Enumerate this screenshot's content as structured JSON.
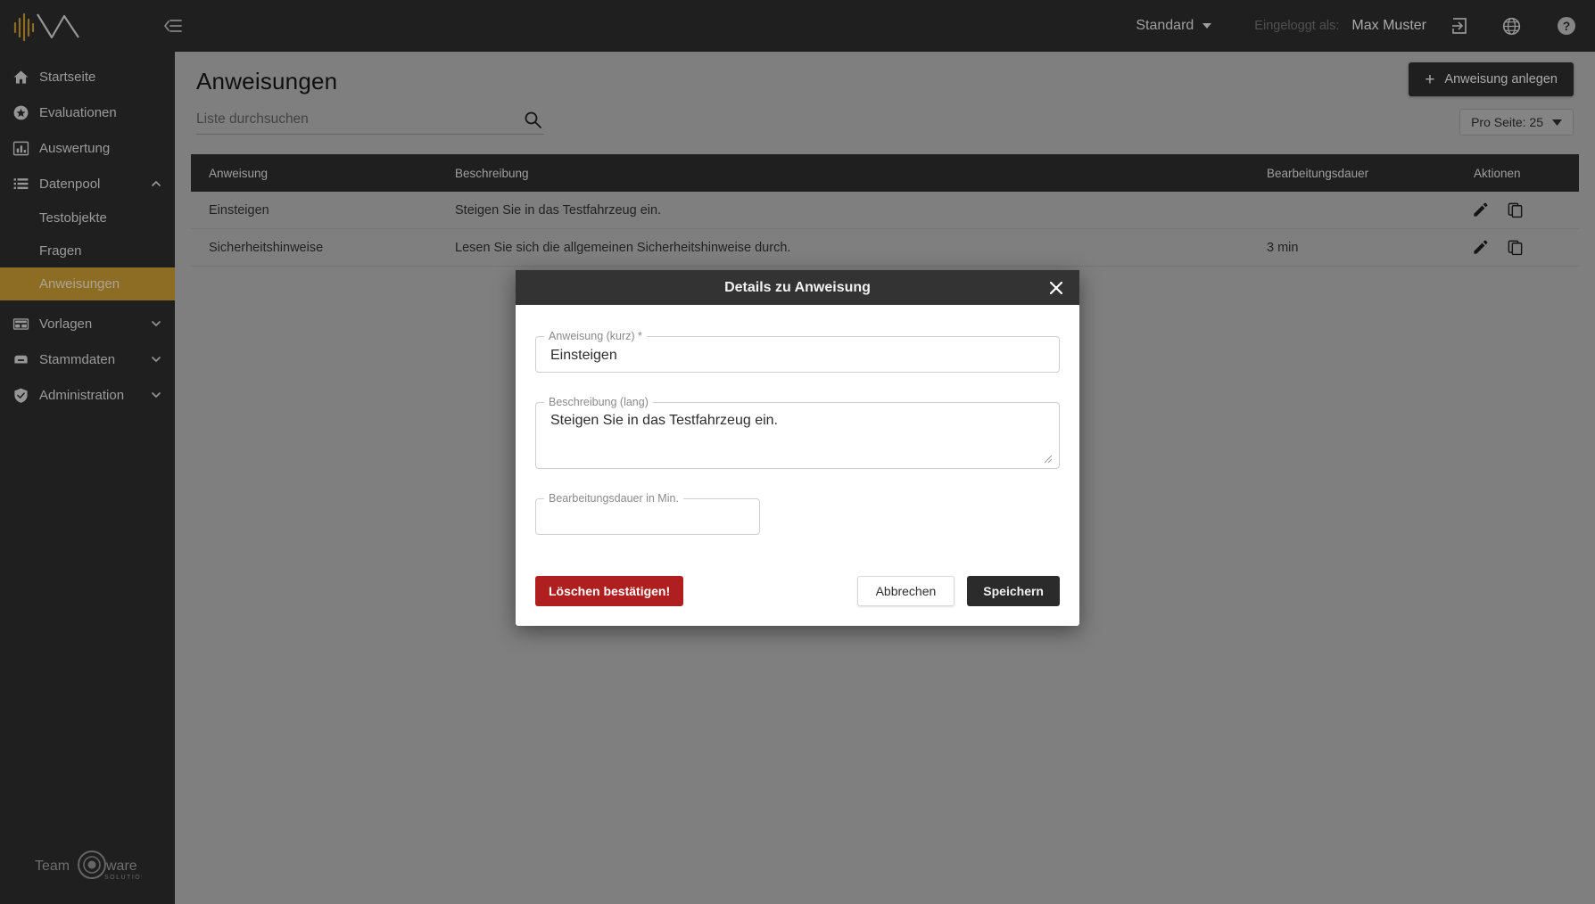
{
  "topbar": {
    "logo_name": "teamware-logo",
    "collapse_icon": "collapse-sidebar-icon",
    "profile_select": "Standard",
    "logged_in_label": "Eingeloggt als:",
    "user_name": "Max Muster",
    "logout_icon": "logout-icon",
    "language_icon": "globe-icon",
    "help_icon": "help-circle-icon"
  },
  "sidebar": {
    "items": [
      {
        "label": "Startseite",
        "icon": "home-icon",
        "level": 0,
        "active": false,
        "chevron": ""
      },
      {
        "label": "Evaluationen",
        "icon": "star-circle-icon",
        "level": 0,
        "active": false,
        "chevron": ""
      },
      {
        "label": "Auswertung",
        "icon": "bar-chart-icon",
        "level": 0,
        "active": false,
        "chevron": ""
      },
      {
        "label": "Datenpool",
        "icon": "database-list-icon",
        "level": 0,
        "active": false,
        "chevron": "up"
      },
      {
        "label": "Testobjekte",
        "icon": "",
        "level": 1,
        "active": false,
        "chevron": ""
      },
      {
        "label": "Fragen",
        "icon": "",
        "level": 1,
        "active": false,
        "chevron": ""
      },
      {
        "label": "Anweisungen",
        "icon": "",
        "level": 1,
        "active": true,
        "chevron": ""
      },
      {
        "label": "Vorlagen",
        "icon": "layout-icon",
        "level": 0,
        "active": false,
        "chevron": "down"
      },
      {
        "label": "Stammdaten",
        "icon": "archive-icon",
        "level": 0,
        "active": false,
        "chevron": "down"
      },
      {
        "label": "Administration",
        "icon": "shield-check-icon",
        "level": 0,
        "active": false,
        "chevron": "down"
      }
    ],
    "footer_logo": {
      "text_left": "Team",
      "text_right": "ware",
      "subtext": "SOLUTIONS"
    }
  },
  "page": {
    "title": "Anweisungen",
    "search_placeholder": "Liste durchsuchen",
    "search_value": "",
    "search_icon": "search-icon",
    "create_button": "Anweisung anlegen",
    "create_icon": "plus-icon",
    "per_page": "Pro Seite: 25"
  },
  "table": {
    "columns": [
      "Anweisung",
      "Beschreibung",
      "Bearbeitungsdauer",
      "Aktionen"
    ],
    "rows": [
      {
        "anweisung": "Einsteigen",
        "beschreibung": "Steigen Sie in das Testfahrzeug ein.",
        "dauer": "",
        "actions": [
          "edit-icon",
          "copy-icon"
        ]
      },
      {
        "anweisung": "Sicherheitshinweise",
        "beschreibung": "Lesen Sie sich die allgemeinen Sicherheitshinweise durch.",
        "dauer": "3 min",
        "actions": [
          "edit-icon",
          "copy-icon"
        ]
      }
    ]
  },
  "modal": {
    "title": "Details zu Anweisung",
    "close_icon": "close-icon",
    "fields": {
      "short": {
        "label": "Anweisung (kurz) *",
        "value": "Einsteigen",
        "placeholder": ""
      },
      "long": {
        "label": "Beschreibung (lang)",
        "value": "Steigen Sie in das Testfahrzeug ein.",
        "placeholder": ""
      },
      "duration": {
        "label": "Bearbeitungsdauer in Min.",
        "value": "",
        "placeholder": ""
      }
    },
    "buttons": {
      "delete": "Löschen bestätigen!",
      "cancel": "Abbrechen",
      "save": "Speichern"
    }
  },
  "colors": {
    "accent": "#c49833",
    "dark": "#2b2b2b",
    "danger": "#b01f1f",
    "page_bg": "#b0b0b0"
  }
}
